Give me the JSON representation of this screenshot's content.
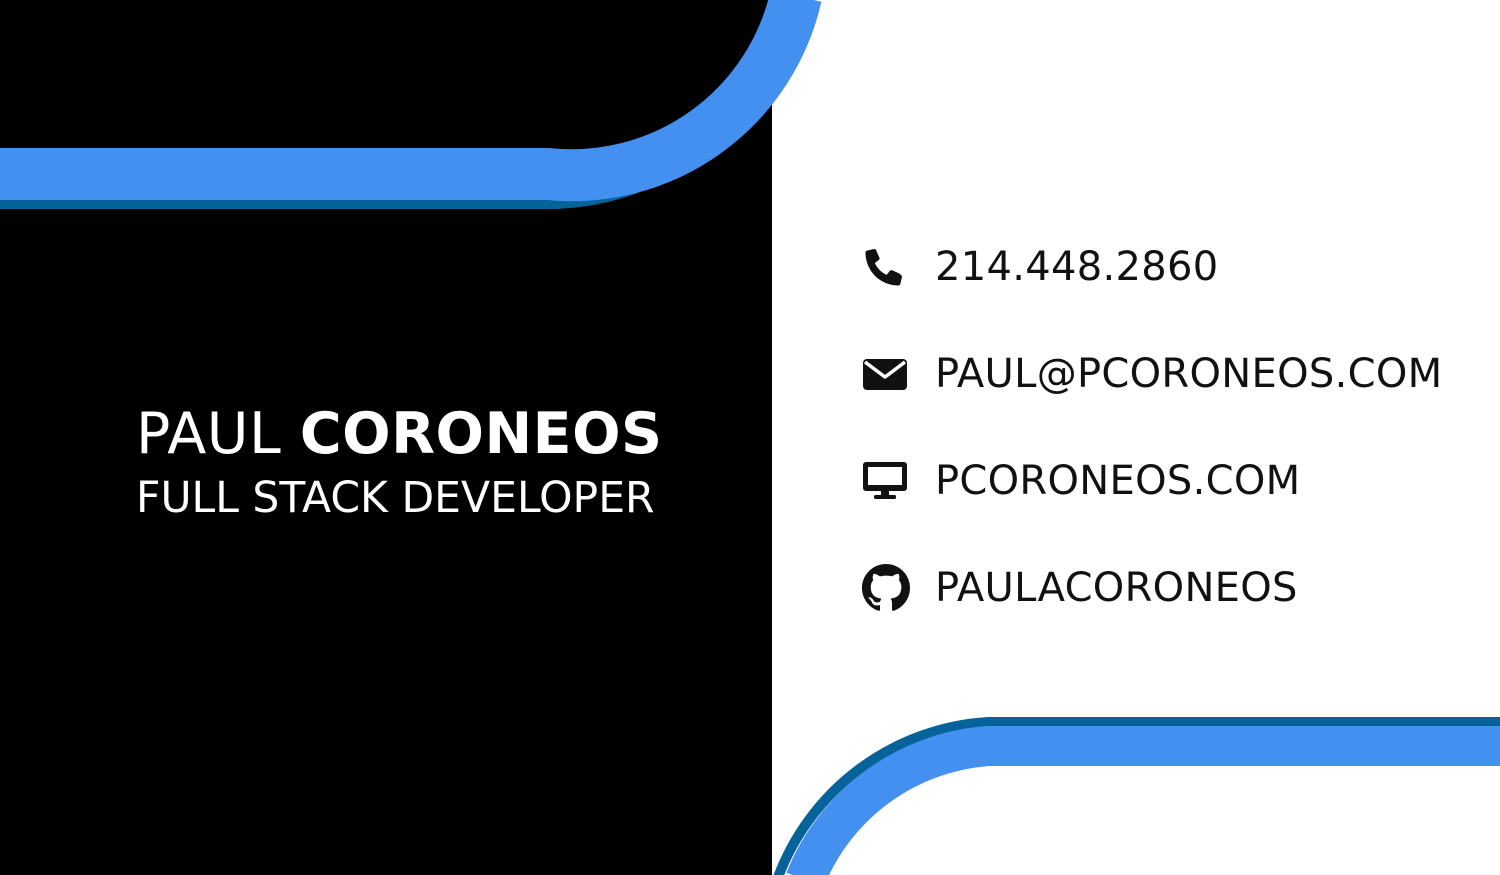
{
  "colors": {
    "background_left": "#000000",
    "background_right": "#ffffff",
    "accent": "#4390f0",
    "accent_dark": "#06639a",
    "text_light": "#ffffff",
    "text_dark": "#111111"
  },
  "identity": {
    "first_name": "PAUL",
    "last_name": "CORONEOS",
    "job_title": "FULL STACK DEVELOPER"
  },
  "contacts": [
    {
      "icon": "phone-icon",
      "text": "214.448.2860"
    },
    {
      "icon": "envelope-icon",
      "text": "PAUL@PCORONEOS.COM"
    },
    {
      "icon": "desktop-icon",
      "text": "PCORONEOS.COM"
    },
    {
      "icon": "github-icon",
      "text": "PAULACORONEOS"
    }
  ]
}
